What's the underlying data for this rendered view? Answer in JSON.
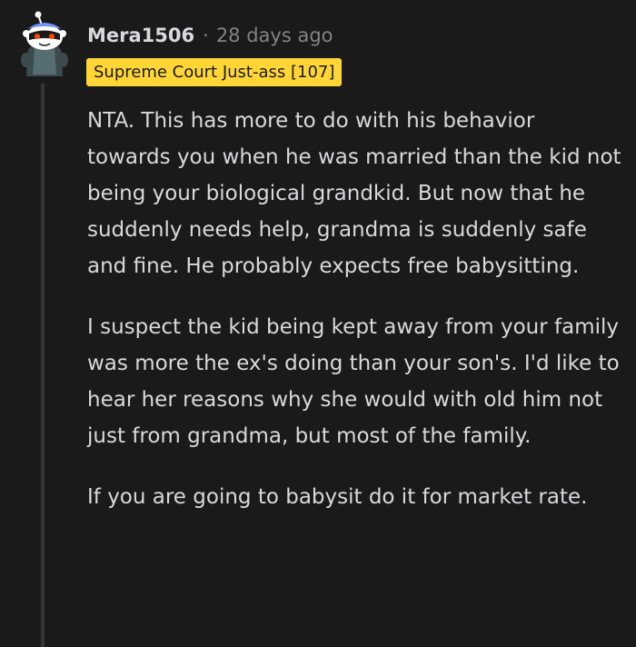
{
  "comment": {
    "username": "Mera1506",
    "separator": "·",
    "timestamp": "28 days ago",
    "flair": "Supreme Court Just-ass [107]",
    "paragraphs": [
      "NTA. This has more to do with his behavior towards you when he was married than the kid not being your biological grandkid. But now that he suddenly needs help, grandma is suddenly safe and fine. He probably expects free babysitting.",
      "I suspect the kid being kept away from your family was more the ex's doing than your son's. I'd like to hear her reasons why she would with old him not just from grandma, but most of the family.",
      "If you are going to babysit do it for market rate."
    ]
  },
  "colors": {
    "background": "#1a1a1b",
    "text": "#d7dadc",
    "meta": "#818384",
    "flair_bg": "#ffd635",
    "thread_line": "#343536"
  },
  "icons": {
    "avatar": "reddit-snoo-avatar"
  }
}
